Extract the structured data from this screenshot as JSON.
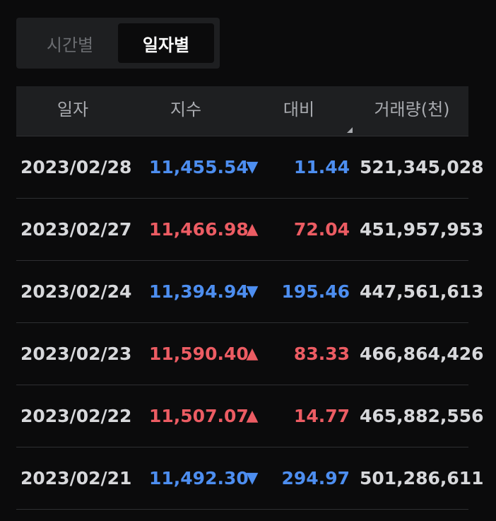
{
  "tabs": {
    "left_label": "시간별",
    "right_label": "일자별"
  },
  "columns": [
    "일자",
    "지수",
    "대비",
    "거래량(천)"
  ],
  "colors": {
    "up": "#ec5c63",
    "down": "#4d8ef0"
  },
  "rows": [
    {
      "date": "2023/02/28",
      "index": "11,455.54",
      "arrow": "▼",
      "change": "11.44",
      "volume": "521,345,028",
      "direction": "down"
    },
    {
      "date": "2023/02/27",
      "index": "11,466.98",
      "arrow": "▲",
      "change": "72.04",
      "volume": "451,957,953",
      "direction": "up"
    },
    {
      "date": "2023/02/24",
      "index": "11,394.94",
      "arrow": "▼",
      "change": "195.46",
      "volume": "447,561,613",
      "direction": "down"
    },
    {
      "date": "2023/02/23",
      "index": "11,590.40",
      "arrow": "▲",
      "change": "83.33",
      "volume": "466,864,426",
      "direction": "up"
    },
    {
      "date": "2023/02/22",
      "index": "11,507.07",
      "arrow": "▲",
      "change": "14.77",
      "volume": "465,882,556",
      "direction": "up"
    },
    {
      "date": "2023/02/21",
      "index": "11,492.30",
      "arrow": "▼",
      "change": "294.97",
      "volume": "501,286,611",
      "direction": "down"
    }
  ]
}
